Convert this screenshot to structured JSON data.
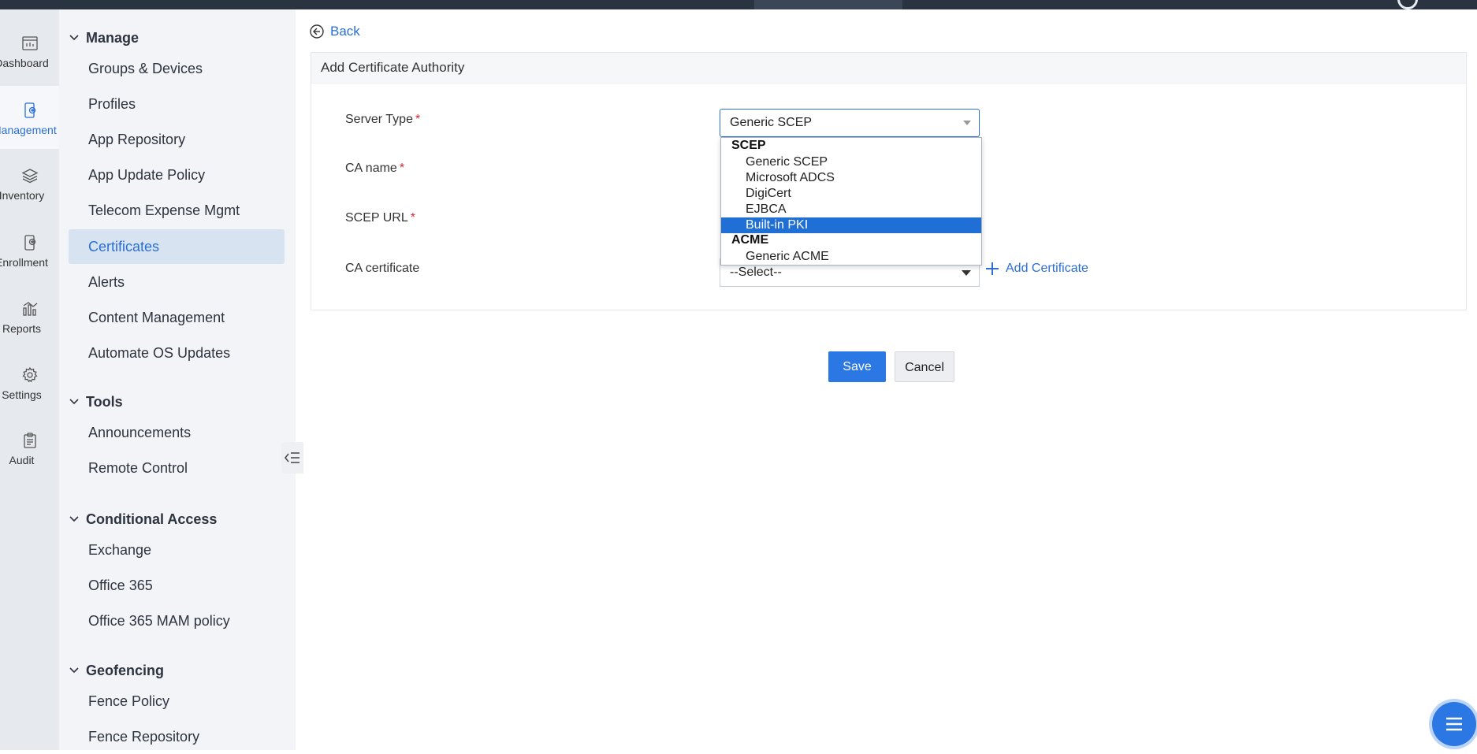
{
  "rail": {
    "items": [
      {
        "label": "Dashboard",
        "icon": "dashboard-icon"
      },
      {
        "label": "Management",
        "icon": "management-icon"
      },
      {
        "label": "Inventory",
        "icon": "inventory-icon"
      },
      {
        "label": "Enrollment",
        "icon": "enrollment-icon"
      },
      {
        "label": "Reports",
        "icon": "reports-icon"
      },
      {
        "label": "Settings",
        "icon": "gear-icon"
      },
      {
        "label": "Audit",
        "icon": "clipboard-icon"
      }
    ]
  },
  "sidebar": {
    "manage": {
      "title": "Manage",
      "items": [
        "Groups & Devices",
        "Profiles",
        "App Repository",
        "App Update Policy",
        "Telecom Expense Mgmt",
        "Certificates",
        "Alerts",
        "Content Management",
        "Automate OS Updates"
      ]
    },
    "tools": {
      "title": "Tools",
      "items": [
        "Announcements",
        "Remote Control"
      ]
    },
    "conditional_access": {
      "title": "Conditional Access",
      "items": [
        "Exchange",
        "Office 365",
        "Office 365 MAM policy"
      ]
    },
    "geofencing": {
      "title": "Geofencing",
      "items": [
        "Fence Policy",
        "Fence Repository"
      ]
    }
  },
  "main": {
    "back_label": "Back",
    "panel_title": "Add Certificate Authority",
    "fields": {
      "server_type_label": "Server Type",
      "ca_name_label": "CA name",
      "scep_url_label": "SCEP URL",
      "ca_certificate_label": "CA certificate",
      "required_mark": "*"
    },
    "server_type_value": "Generic SCEP",
    "dropdown": {
      "groups": [
        {
          "label": "SCEP",
          "options": [
            "Generic SCEP",
            "Microsoft ADCS",
            "DigiCert",
            "EJBCA",
            "Built-in PKI"
          ]
        },
        {
          "label": "ACME",
          "options": [
            "Generic ACME"
          ]
        }
      ],
      "highlighted": "Built-in PKI"
    },
    "ca_certificate_value": "--Select--",
    "add_certificate_label": "Add Certificate",
    "save_label": "Save",
    "cancel_label": "Cancel"
  },
  "colors": {
    "accent": "#2b6fd6",
    "primary_button": "#2b78e4",
    "highlight": "#1f6fd4",
    "required": "#d9282f"
  }
}
